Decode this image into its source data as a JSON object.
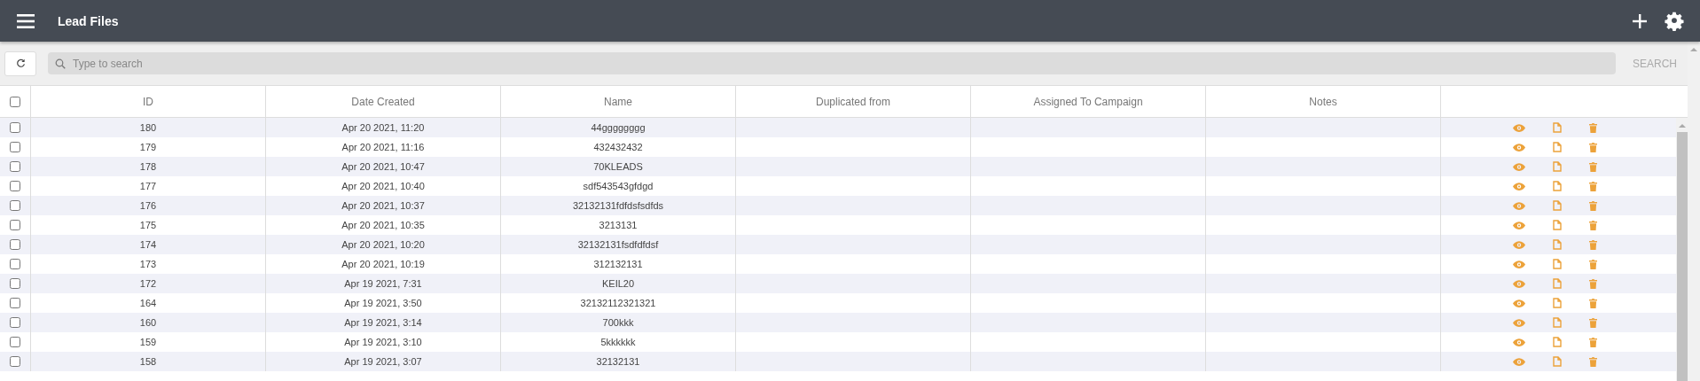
{
  "header": {
    "title": "Lead Files"
  },
  "toolbar": {
    "search": {
      "placeholder": "Type to search"
    },
    "search_button": "SEARCH"
  },
  "table": {
    "select_all": {
      "checked": false
    },
    "columns": [
      "ID",
      "Date Created",
      "Name",
      "Duplicated from",
      "Assigned To Campaign",
      "Notes"
    ],
    "rows": [
      {
        "selected": false,
        "id": "180",
        "date_created": "Apr 20 2021, 11:20",
        "name": "44gggggggg"
      },
      {
        "selected": false,
        "id": "179",
        "date_created": "Apr 20 2021, 11:16",
        "name": "432432432"
      },
      {
        "selected": false,
        "id": "178",
        "date_created": "Apr 20 2021, 10:47",
        "name": "70KLEADS"
      },
      {
        "selected": false,
        "id": "177",
        "date_created": "Apr 20 2021, 10:40",
        "name": "sdf543543gfdgd"
      },
      {
        "selected": false,
        "id": "176",
        "date_created": "Apr 20 2021, 10:37",
        "name": "32132131fdfdsfsdfds"
      },
      {
        "selected": false,
        "id": "175",
        "date_created": "Apr 20 2021, 10:35",
        "name": "3213131"
      },
      {
        "selected": false,
        "id": "174",
        "date_created": "Apr 20 2021, 10:20",
        "name": "32132131fsdfdfdsf"
      },
      {
        "selected": false,
        "id": "173",
        "date_created": "Apr 20 2021, 10:19",
        "name": "312132131"
      },
      {
        "selected": false,
        "id": "172",
        "date_created": "Apr 19 2021, 7:31",
        "name": "KEIL20"
      },
      {
        "selected": false,
        "id": "164",
        "date_created": "Apr 19 2021, 3:50",
        "name": "32132112321321"
      },
      {
        "selected": false,
        "id": "160",
        "date_created": "Apr 19 2021, 3:14",
        "name": "700kkk"
      },
      {
        "selected": false,
        "id": "159",
        "date_created": "Apr 19 2021, 3:10",
        "name": "5kkkkkk"
      },
      {
        "selected": false,
        "id": "158",
        "date_created": "Apr 19 2021, 3:07",
        "name": "32132131"
      }
    ]
  }
}
